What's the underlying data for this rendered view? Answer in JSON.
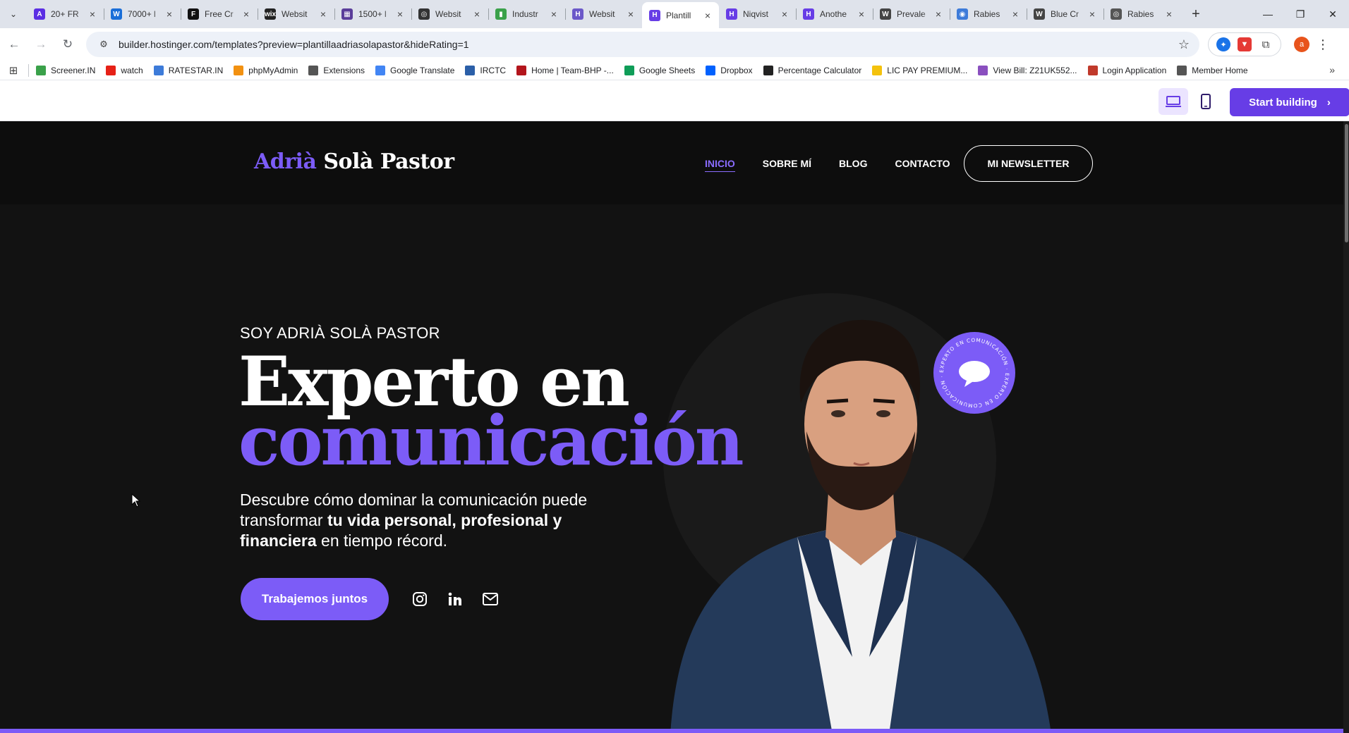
{
  "browser": {
    "tabs": [
      {
        "title": "20+ FR",
        "fav": "#5b2ee3",
        "glyph": "A"
      },
      {
        "title": "7000+ l",
        "fav": "#1a6ed8",
        "glyph": "W"
      },
      {
        "title": "Free Cr",
        "fav": "#111111",
        "glyph": "F"
      },
      {
        "title": "Websit",
        "fav": "#222222",
        "glyph": "wix"
      },
      {
        "title": "1500+ l",
        "fav": "#5a3d9a",
        "glyph": "▦"
      },
      {
        "title": "Websit",
        "fav": "#333333",
        "glyph": "◎"
      },
      {
        "title": "Industr",
        "fav": "#3aa14a",
        "glyph": "▮"
      },
      {
        "title": "Websit",
        "fav": "#6b58c9",
        "glyph": "H"
      },
      {
        "title": "Plantill",
        "fav": "#673de6",
        "glyph": "H"
      },
      {
        "title": "Niqvist",
        "fav": "#673de6",
        "glyph": "H"
      },
      {
        "title": "Anothe",
        "fav": "#673de6",
        "glyph": "H"
      },
      {
        "title": "Prevale",
        "fav": "#444444",
        "glyph": "W"
      },
      {
        "title": "Rabies",
        "fav": "#3d7bd9",
        "glyph": "◉"
      },
      {
        "title": "Blue Cr",
        "fav": "#444444",
        "glyph": "W"
      },
      {
        "title": "Rabies",
        "fav": "#555555",
        "glyph": "◎"
      }
    ],
    "active_tab_index": 8,
    "url": "builder.hostinger.com/templates?preview=plantillaadriasolapastor&hideRating=1",
    "profile_initial": "a"
  },
  "bookmarks": [
    {
      "label": "Screener.IN",
      "color": "#3aa14a"
    },
    {
      "label": "watch",
      "color": "#e62117"
    },
    {
      "label": "RATESTAR.IN",
      "color": "#3d7bd9"
    },
    {
      "label": "phpMyAdmin",
      "color": "#f29111"
    },
    {
      "label": "Extensions",
      "color": "#555555"
    },
    {
      "label": "Google Translate",
      "color": "#4285f4"
    },
    {
      "label": "IRCTC",
      "color": "#2b5fa8"
    },
    {
      "label": "Home | Team-BHP -...",
      "color": "#b3151c"
    },
    {
      "label": "Google Sheets",
      "color": "#0f9d58"
    },
    {
      "label": "Dropbox",
      "color": "#0061fe"
    },
    {
      "label": "Percentage Calculator",
      "color": "#222222"
    },
    {
      "label": "LIC PAY PREMIUM...",
      "color": "#f4c20d"
    },
    {
      "label": "View Bill: Z21UK552...",
      "color": "#8a4fbf"
    },
    {
      "label": "Login Application",
      "color": "#c0392b"
    },
    {
      "label": "Member Home",
      "color": "#555555"
    }
  ],
  "builder": {
    "start_label": "Start building"
  },
  "site": {
    "logo_first": "Adrià",
    "logo_rest": "Solà Pastor",
    "nav": [
      "INICIO",
      "SOBRE MÍ",
      "BLOG",
      "CONTACTO"
    ],
    "newsletter": "MI NEWSLETTER",
    "eyebrow": "SOY ADRIÀ SOLÀ PASTOR",
    "headline_1": "Experto en",
    "headline_2": "comunicación",
    "lede_1": "Descubre cómo dominar la comunicación puede transformar ",
    "lede_bold": "tu vida personal, profesional y financiera",
    "lede_2": " en tiempo récord.",
    "cta": "Trabajemos juntos",
    "badge_text": "EXPERTO EN COMUNICACIÓN · EXPERTO EN COMUNICACIÓN ·"
  },
  "colors": {
    "brand": "#7c5cf7",
    "hostinger": "#673de6",
    "page_bg": "#121212"
  }
}
